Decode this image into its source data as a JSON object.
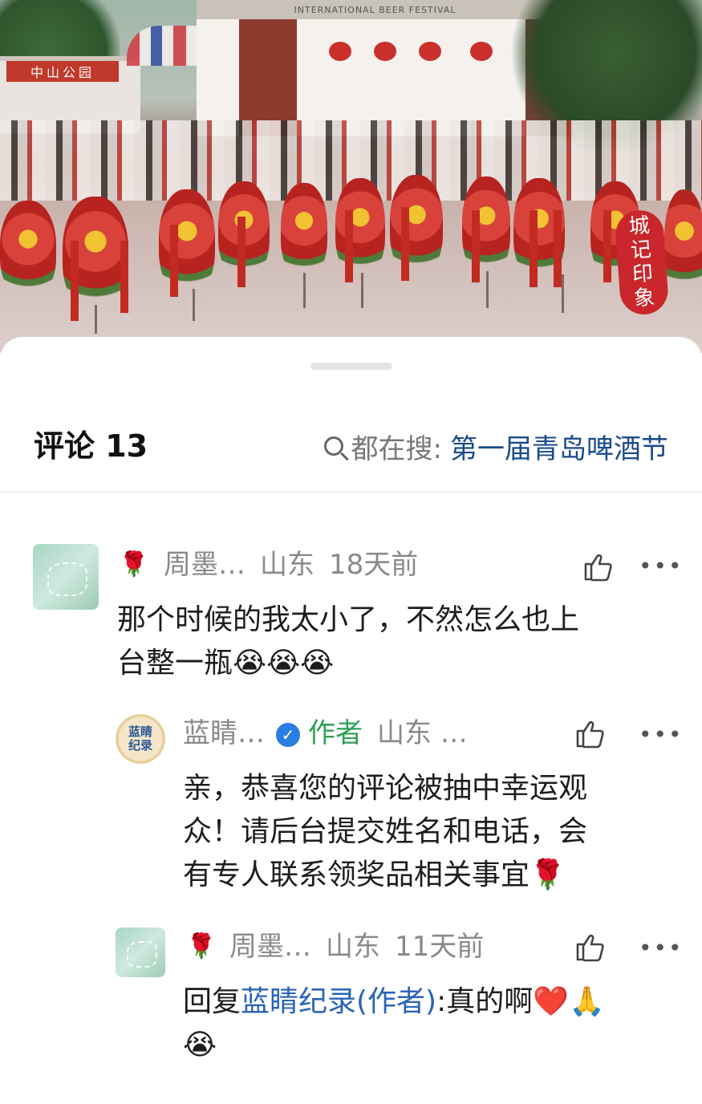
{
  "photo": {
    "sign_left": "中山公园",
    "gate_banner": "INTERNATIONAL BEER FESTIVAL",
    "watermark": [
      "城",
      "记",
      "印",
      "象"
    ]
  },
  "comments_header": {
    "title": "评论 13",
    "search_label": "都在搜:",
    "search_keyword": "第一届青岛啤酒节"
  },
  "comments": [
    {
      "username": "周墨…",
      "badge_emoji": "🌹",
      "location": "山东",
      "time": "18天前",
      "text_line1": "那个时候的我太小了，不然怎么也上",
      "text_line2": "台整一瓶😭😭😭"
    }
  ],
  "replies": [
    {
      "username": "蓝睛…",
      "avatar_text": "蓝睛纪录",
      "verified_mark": "✓",
      "author_tag": "作者",
      "location": "山东 …",
      "text_line1": "亲，恭喜您的评论被抽中幸运观",
      "text_line2": "众！请后台提交姓名和电话，会",
      "text_line3": "有专人联系领奖品相关事宜🌹"
    },
    {
      "username": "周墨…",
      "badge_emoji": "🌹",
      "location": "山东",
      "time": "11天前",
      "reply_prefix": "回复",
      "reply_target": "蓝睛纪录(作者)",
      "reply_text": ":真的啊❤️🙏",
      "text_line2": "😭"
    }
  ],
  "icons": {
    "like": "thumbs-up-icon",
    "more": "more-dots-icon",
    "search": "search-icon"
  },
  "colors": {
    "search_keyword": "#1a4b8c",
    "author_tag": "#2f9e55",
    "verified": "#2a7de1",
    "reply_link": "#2a63b8"
  }
}
